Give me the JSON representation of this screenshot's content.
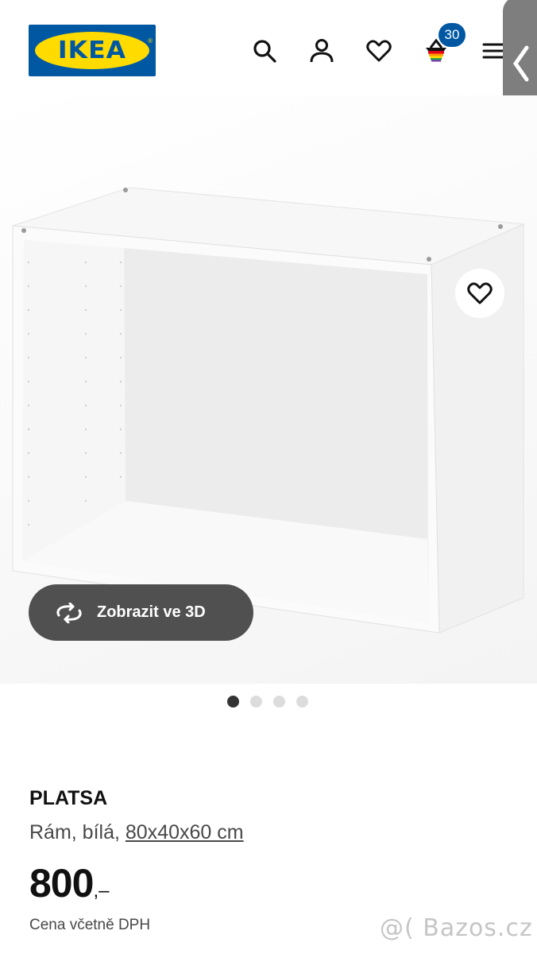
{
  "header": {
    "logo_text": "IKEA",
    "logo_reg": "®",
    "cart_count": "30",
    "icons": [
      "search-icon",
      "user-icon",
      "heart-icon",
      "cart-icon",
      "menu-icon"
    ]
  },
  "side_tab": {
    "icon": "chevron-left-icon"
  },
  "gallery": {
    "view3d_label": "Zobrazit ve 3D",
    "slide_count": 4,
    "active_slide": 1
  },
  "product": {
    "name": "PLATSA",
    "description_prefix": "Rám, bílá, ",
    "size": "80x40x60 cm",
    "price": "800",
    "price_suffix": ",–",
    "vat_note": "Cena včetně DPH"
  },
  "watermark": "@( Bazos.cz",
  "colors": {
    "ikea_blue": "#0058a3",
    "ikea_yellow": "#ffdb00",
    "button_dark": "#505050"
  }
}
